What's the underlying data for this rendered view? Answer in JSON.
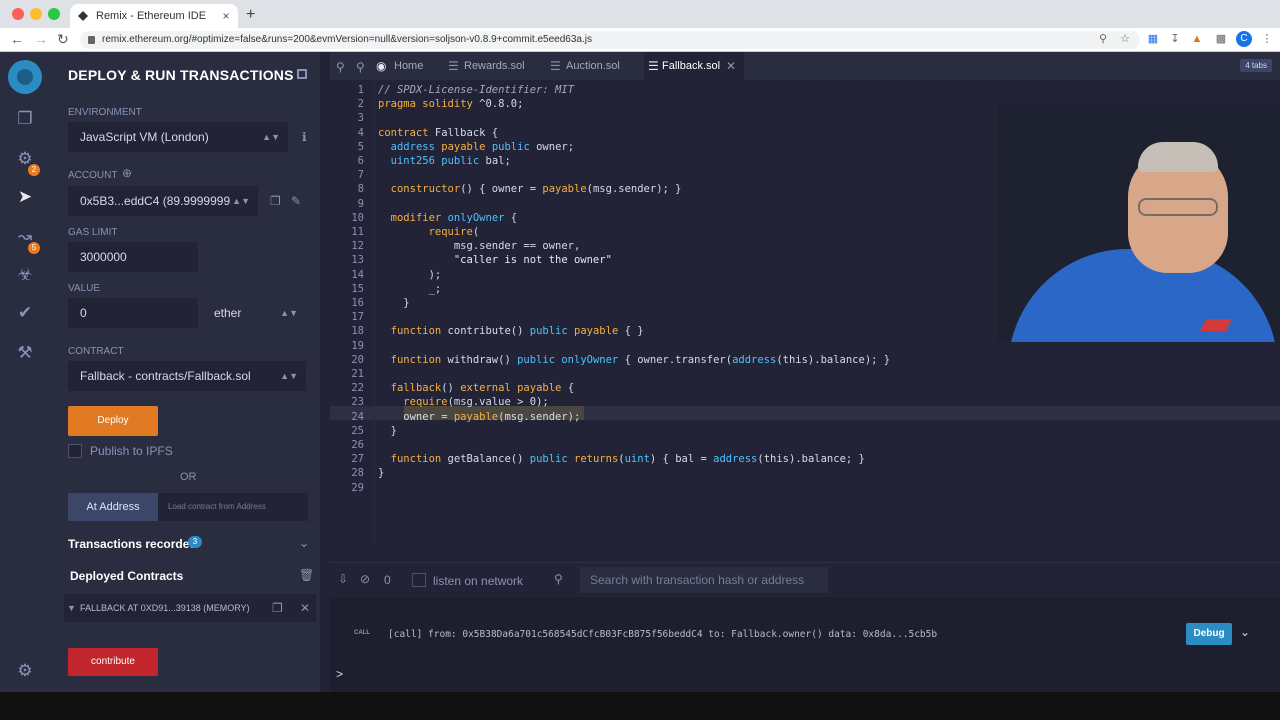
{
  "browser": {
    "tab_title": "Remix - Ethereum IDE",
    "tab_close": "×",
    "new_tab": "+",
    "url": "remix.ethereum.org/#optimize=false&runs=200&evmVersion=null&version=soljson-v0.8.9+commit.e5eed63a.js",
    "profile_initial": "C"
  },
  "sidebar": {
    "title": "DEPLOY & RUN TRANSACTIONS",
    "environment_label": "ENVIRONMENT",
    "environment_value": "JavaScript VM (London)",
    "account_label": "ACCOUNT",
    "account_value": "0x5B3...eddC4 (89.9999999",
    "gas_limit_label": "GAS LIMIT",
    "gas_limit_value": "3000000",
    "value_label": "VALUE",
    "value_amount": "0",
    "value_unit": "ether",
    "contract_label": "CONTRACT",
    "contract_value": "Fallback - contracts/Fallback.sol",
    "deploy_label": "Deploy",
    "publish_label": "Publish to IPFS",
    "or_label": "OR",
    "at_address_label": "At Address",
    "at_address_placeholder": "Load contract from Address",
    "transactions_label": "Transactions recorded",
    "transactions_count": "3",
    "deployed_label": "Deployed Contracts",
    "deployed_item": "FALLBACK AT 0XD91...39138 (MEMORY)",
    "contribute_label": "contribute",
    "badges": {
      "compiler": "2",
      "analysis": "5"
    }
  },
  "editor": {
    "tabs": [
      {
        "label": "Home"
      },
      {
        "label": "Rewards.sol"
      },
      {
        "label": "Auction.sol"
      },
      {
        "label": "Fallback.sol"
      }
    ],
    "tabs_count": "4 tabs",
    "lines": [
      "// SPDX-License-Identifier: MIT",
      "pragma solidity ^0.8.0;",
      "",
      "contract Fallback {",
      "  address payable public owner;",
      "  uint256 public bal;",
      "",
      "  constructor() { owner = payable(msg.sender); }",
      "",
      "  modifier onlyOwner {",
      "        require(",
      "            msg.sender == owner,",
      "            \"caller is not the owner\"",
      "        );",
      "        _;",
      "    }",
      "",
      "  function contribute() public payable { }",
      "",
      "  function withdraw() public onlyOwner { owner.transfer(address(this).balance); }",
      "",
      "  fallback() external payable {",
      "    require(msg.value > 0);",
      "    owner = payable(msg.sender);",
      "  }",
      "",
      "  function getBalance() public returns(uint) { bal = address(this).balance; }",
      "}",
      ""
    ]
  },
  "terminal": {
    "count": "0",
    "listen_label": "listen on network",
    "search_placeholder": "Search with transaction hash or address",
    "call_tag": "CALL",
    "log": "[call] from: 0x5B38Da6a701c568545dCfcB03FcB875f56beddC4 to: Fallback.owner() data: 0x8da...5cb5b",
    "debug_label": "Debug",
    "prompt": ">"
  }
}
